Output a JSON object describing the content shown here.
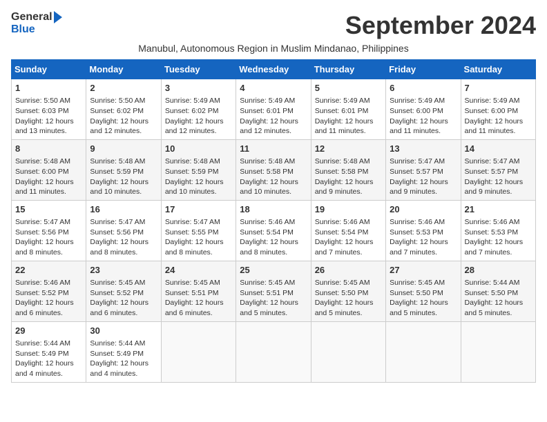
{
  "header": {
    "logo_general": "General",
    "logo_blue": "Blue",
    "month_title": "September 2024",
    "subtitle": "Manubul, Autonomous Region in Muslim Mindanao, Philippines"
  },
  "days_of_week": [
    "Sunday",
    "Monday",
    "Tuesday",
    "Wednesday",
    "Thursday",
    "Friday",
    "Saturday"
  ],
  "weeks": [
    {
      "shaded": false,
      "days": [
        {
          "num": "1",
          "lines": [
            "Sunrise: 5:50 AM",
            "Sunset: 6:03 PM",
            "Daylight: 12 hours",
            "and 13 minutes."
          ]
        },
        {
          "num": "2",
          "lines": [
            "Sunrise: 5:50 AM",
            "Sunset: 6:02 PM",
            "Daylight: 12 hours",
            "and 12 minutes."
          ]
        },
        {
          "num": "3",
          "lines": [
            "Sunrise: 5:49 AM",
            "Sunset: 6:02 PM",
            "Daylight: 12 hours",
            "and 12 minutes."
          ]
        },
        {
          "num": "4",
          "lines": [
            "Sunrise: 5:49 AM",
            "Sunset: 6:01 PM",
            "Daylight: 12 hours",
            "and 12 minutes."
          ]
        },
        {
          "num": "5",
          "lines": [
            "Sunrise: 5:49 AM",
            "Sunset: 6:01 PM",
            "Daylight: 12 hours",
            "and 11 minutes."
          ]
        },
        {
          "num": "6",
          "lines": [
            "Sunrise: 5:49 AM",
            "Sunset: 6:00 PM",
            "Daylight: 12 hours",
            "and 11 minutes."
          ]
        },
        {
          "num": "7",
          "lines": [
            "Sunrise: 5:49 AM",
            "Sunset: 6:00 PM",
            "Daylight: 12 hours",
            "and 11 minutes."
          ]
        }
      ]
    },
    {
      "shaded": true,
      "days": [
        {
          "num": "8",
          "lines": [
            "Sunrise: 5:48 AM",
            "Sunset: 6:00 PM",
            "Daylight: 12 hours",
            "and 11 minutes."
          ]
        },
        {
          "num": "9",
          "lines": [
            "Sunrise: 5:48 AM",
            "Sunset: 5:59 PM",
            "Daylight: 12 hours",
            "and 10 minutes."
          ]
        },
        {
          "num": "10",
          "lines": [
            "Sunrise: 5:48 AM",
            "Sunset: 5:59 PM",
            "Daylight: 12 hours",
            "and 10 minutes."
          ]
        },
        {
          "num": "11",
          "lines": [
            "Sunrise: 5:48 AM",
            "Sunset: 5:58 PM",
            "Daylight: 12 hours",
            "and 10 minutes."
          ]
        },
        {
          "num": "12",
          "lines": [
            "Sunrise: 5:48 AM",
            "Sunset: 5:58 PM",
            "Daylight: 12 hours",
            "and 9 minutes."
          ]
        },
        {
          "num": "13",
          "lines": [
            "Sunrise: 5:47 AM",
            "Sunset: 5:57 PM",
            "Daylight: 12 hours",
            "and 9 minutes."
          ]
        },
        {
          "num": "14",
          "lines": [
            "Sunrise: 5:47 AM",
            "Sunset: 5:57 PM",
            "Daylight: 12 hours",
            "and 9 minutes."
          ]
        }
      ]
    },
    {
      "shaded": false,
      "days": [
        {
          "num": "15",
          "lines": [
            "Sunrise: 5:47 AM",
            "Sunset: 5:56 PM",
            "Daylight: 12 hours",
            "and 8 minutes."
          ]
        },
        {
          "num": "16",
          "lines": [
            "Sunrise: 5:47 AM",
            "Sunset: 5:56 PM",
            "Daylight: 12 hours",
            "and 8 minutes."
          ]
        },
        {
          "num": "17",
          "lines": [
            "Sunrise: 5:47 AM",
            "Sunset: 5:55 PM",
            "Daylight: 12 hours",
            "and 8 minutes."
          ]
        },
        {
          "num": "18",
          "lines": [
            "Sunrise: 5:46 AM",
            "Sunset: 5:54 PM",
            "Daylight: 12 hours",
            "and 8 minutes."
          ]
        },
        {
          "num": "19",
          "lines": [
            "Sunrise: 5:46 AM",
            "Sunset: 5:54 PM",
            "Daylight: 12 hours",
            "and 7 minutes."
          ]
        },
        {
          "num": "20",
          "lines": [
            "Sunrise: 5:46 AM",
            "Sunset: 5:53 PM",
            "Daylight: 12 hours",
            "and 7 minutes."
          ]
        },
        {
          "num": "21",
          "lines": [
            "Sunrise: 5:46 AM",
            "Sunset: 5:53 PM",
            "Daylight: 12 hours",
            "and 7 minutes."
          ]
        }
      ]
    },
    {
      "shaded": true,
      "days": [
        {
          "num": "22",
          "lines": [
            "Sunrise: 5:46 AM",
            "Sunset: 5:52 PM",
            "Daylight: 12 hours",
            "and 6 minutes."
          ]
        },
        {
          "num": "23",
          "lines": [
            "Sunrise: 5:45 AM",
            "Sunset: 5:52 PM",
            "Daylight: 12 hours",
            "and 6 minutes."
          ]
        },
        {
          "num": "24",
          "lines": [
            "Sunrise: 5:45 AM",
            "Sunset: 5:51 PM",
            "Daylight: 12 hours",
            "and 6 minutes."
          ]
        },
        {
          "num": "25",
          "lines": [
            "Sunrise: 5:45 AM",
            "Sunset: 5:51 PM",
            "Daylight: 12 hours",
            "and 5 minutes."
          ]
        },
        {
          "num": "26",
          "lines": [
            "Sunrise: 5:45 AM",
            "Sunset: 5:50 PM",
            "Daylight: 12 hours",
            "and 5 minutes."
          ]
        },
        {
          "num": "27",
          "lines": [
            "Sunrise: 5:45 AM",
            "Sunset: 5:50 PM",
            "Daylight: 12 hours",
            "and 5 minutes."
          ]
        },
        {
          "num": "28",
          "lines": [
            "Sunrise: 5:44 AM",
            "Sunset: 5:50 PM",
            "Daylight: 12 hours",
            "and 5 minutes."
          ]
        }
      ]
    },
    {
      "shaded": false,
      "partial": true,
      "days": [
        {
          "num": "29",
          "lines": [
            "Sunrise: 5:44 AM",
            "Sunset: 5:49 PM",
            "Daylight: 12 hours",
            "and 4 minutes."
          ]
        },
        {
          "num": "30",
          "lines": [
            "Sunrise: 5:44 AM",
            "Sunset: 5:49 PM",
            "Daylight: 12 hours",
            "and 4 minutes."
          ]
        },
        {
          "num": "",
          "lines": []
        },
        {
          "num": "",
          "lines": []
        },
        {
          "num": "",
          "lines": []
        },
        {
          "num": "",
          "lines": []
        },
        {
          "num": "",
          "lines": []
        }
      ]
    }
  ]
}
